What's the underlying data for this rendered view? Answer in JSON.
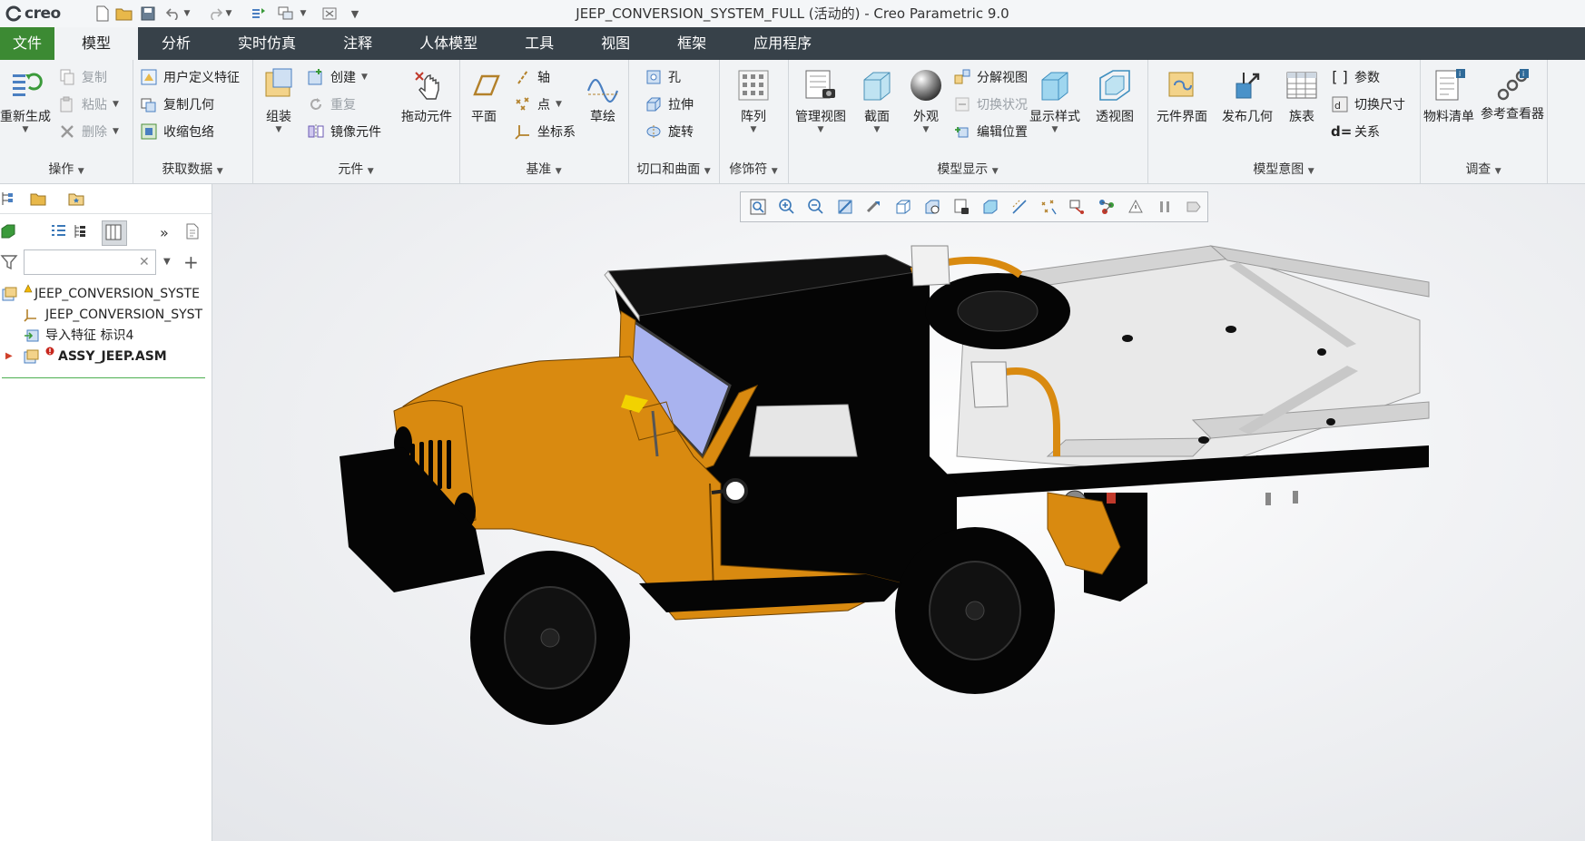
{
  "window": {
    "title": "JEEP_CONVERSION_SYSTEM_FULL (活动的) - Creo Parametric 9.0",
    "logo": "creo"
  },
  "tabs": [
    "文件",
    "模型",
    "分析",
    "实时仿真",
    "注释",
    "人体模型",
    "工具",
    "视图",
    "框架",
    "应用程序"
  ],
  "active_tab": "模型",
  "ribbon": {
    "operations": {
      "label": "操作",
      "regenerate": "重新生成",
      "copy": "复制",
      "paste": "粘贴",
      "delete": "删除"
    },
    "get_data": {
      "label": "获取数据",
      "udf": "用户定义特征",
      "copy_geom": "复制几何",
      "shrinkwrap": "收缩包络"
    },
    "component": {
      "label": "元件",
      "assemble": "组装",
      "create": "创建",
      "repeat": "重复",
      "mirror": "镜像元件",
      "drag": "拖动元件"
    },
    "datum": {
      "label": "基准",
      "plane": "平面",
      "axis": "轴",
      "point": "点",
      "csys": "坐标系",
      "sketch": "草绘"
    },
    "cut_surface": {
      "label": "切口和曲面",
      "hole": "孔",
      "extrude": "拉伸",
      "revolve": "旋转"
    },
    "modifiers": {
      "label": "修饰符",
      "pattern": "阵列"
    },
    "model_display": {
      "label": "模型显示",
      "manage_views": "管理视图",
      "section": "截面",
      "appearance": "外观",
      "explode": "分解视图",
      "toggle_status": "切换状况",
      "edit_position": "编辑位置",
      "display_style": "显示样式",
      "perspective": "透视图"
    },
    "model_intent": {
      "label": "模型意图",
      "component_interface": "元件界面",
      "publish_geom": "发布几何",
      "family_table": "族表",
      "parameters": "参数",
      "switch_dims": "切换尺寸",
      "relations": "关系"
    },
    "investigate": {
      "label": "调查",
      "bom": "物料清单",
      "ref_viewer": "参考查看器"
    }
  },
  "model_tree": {
    "filter_placeholder": "",
    "items": [
      {
        "label": "JEEP_CONVERSION_SYSTE",
        "type": "assembly-warning"
      },
      {
        "label": "JEEP_CONVERSION_SYST",
        "type": "csys"
      },
      {
        "label": "导入特征 标识4",
        "type": "import"
      },
      {
        "label": "ASSY_JEEP.ASM",
        "type": "assembly-error"
      }
    ]
  },
  "colors": {
    "file_tab": "#3c8a33",
    "tab_bar": "#374149",
    "ribbon_bg": "#f1f3f5",
    "jeep_orange": "#d98a10",
    "jeep_black": "#050505"
  }
}
